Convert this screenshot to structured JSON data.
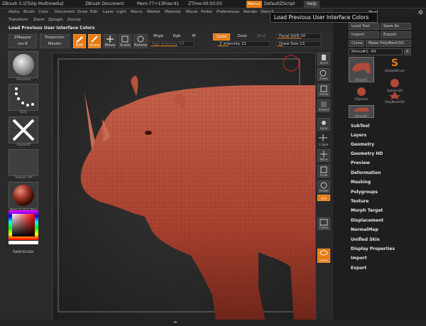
{
  "titlebar": {
    "app": "ZBrush 3.1[Tulip Multimedia]",
    "doc": "ZBrush Document",
    "mem": "Mem:77+13",
    "free": "Free:91",
    "ztime": "ZTime:00:03:03",
    "menus": "Menus",
    "script": "DefaultZScript",
    "help": "Help"
  },
  "menubar": [
    "Alpha",
    "Brush",
    "Color",
    "Document",
    "Draw",
    "Edit",
    "Layer",
    "Light",
    "Macro",
    "Marker",
    "Material",
    "Movie",
    "Picker",
    "Preferences",
    "Render",
    "Stencil"
  ],
  "menubar2": [
    "Transform",
    "Zoom",
    "Zplugin",
    "Zscript"
  ],
  "status": "Load Previous User Interface Colors",
  "tooltip": "Load Previous User Interface Colors",
  "toolbar": {
    "zmapper": "ZMapper",
    "zmapper_rev": "rev-E",
    "projection": "Projection",
    "master": "Master",
    "edit": "Edit",
    "draw": "Draw",
    "move": "Move",
    "scale": "Scale",
    "rotate": "Rotate",
    "mrgb": "Mrgb",
    "rgb": "Rgb",
    "m": "M",
    "rgb_intensity": "Rgb Intensity 63",
    "zadd": "Zadd",
    "zsub": "Zsub",
    "zcut": "Zcut",
    "z_intensity": "Z Intensity 21",
    "focal_shift": "Focal Shift 10",
    "draw_size": "Draw Size 13"
  },
  "leftbar": {
    "captions": [
      "Standard",
      "Dots",
      "AlphaOff",
      "Texture Off",
      "MatCap Red Wax"
    ],
    "switch_color": "SwitchColor"
  },
  "rightbar": [
    "Scroll",
    "Zoom",
    "Actual",
    "AAHalf",
    "Local",
    "L.Sym",
    "Move",
    "Scale",
    "Rotate",
    "XYZ",
    "Frame",
    "Lasso"
  ],
  "tray": {
    "title": "Tool",
    "load_tool": "Load Tool",
    "save_as": "Save As",
    "import": "Import",
    "export": "Export",
    "clone": "Clone",
    "make_polymesh": "Make PolyMesh3D",
    "rhino_slider": "Rhino#1. 49",
    "r": "R",
    "tools": [
      {
        "label": "Rhino#1"
      },
      {
        "label": "SimpleBrush"
      },
      {
        "label": "Sphere3D"
      },
      {
        "label": "ZSphere"
      },
      {
        "label": "PolyMesh3D"
      },
      {
        "label": "Rhino#1"
      }
    ],
    "menu": [
      "SubTool",
      "Layers",
      "Geometry",
      "Geometry HD",
      "Preview",
      "Deformation",
      "Masking",
      "Polygroups",
      "Texture",
      "Morph Target",
      "Displacement",
      "NormalMap",
      "Unified Skin",
      "Display Properties",
      "Import",
      "Export"
    ]
  },
  "colors": {
    "accent": "#e87a16",
    "background": "#2a2a2a",
    "rhino": "#b24a3a"
  },
  "sliders": {
    "rgb_intensity": 0.63,
    "z_intensity": 0.21,
    "focal_shift": 0.55,
    "draw_size": 0.13
  }
}
